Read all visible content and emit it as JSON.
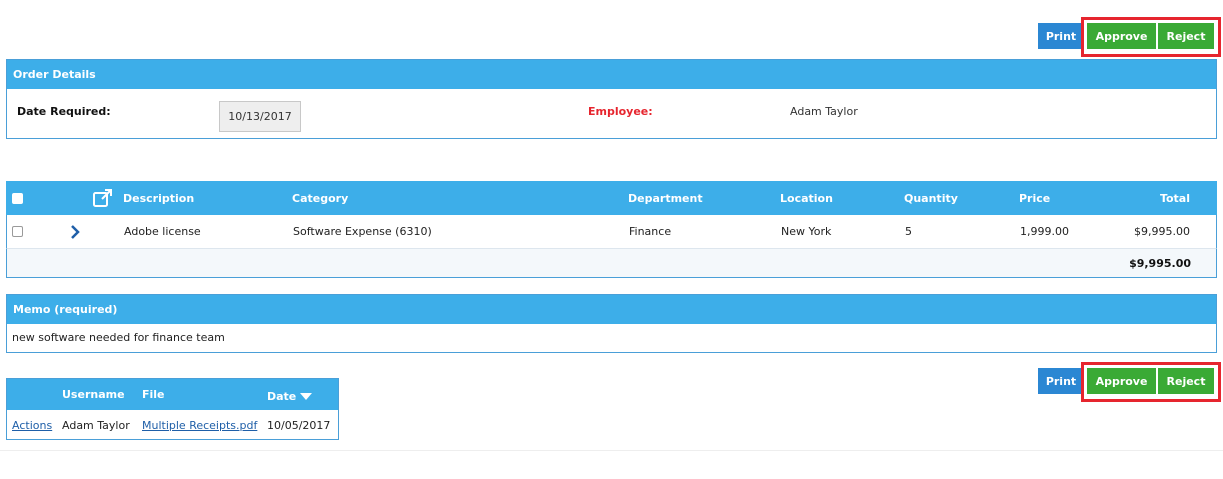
{
  "top_actions": {
    "print": "Print",
    "approve": "Approve",
    "reject": "Reject"
  },
  "order_details": {
    "title": "Order Details",
    "date_required_label": "Date Required:",
    "date_required_value": "10/13/2017",
    "employee_label": "Employee:",
    "employee_value": "Adam Taylor"
  },
  "items_table": {
    "columns": [
      "Description",
      "Category",
      "Department",
      "Location",
      "Quantity",
      "Price",
      "Total"
    ],
    "rows": [
      {
        "description": "Adobe license",
        "category": "Software Expense (6310)",
        "department": "Finance",
        "location": "New York",
        "quantity": "5",
        "price": "1,999.00",
        "total": "$9,995.00"
      }
    ],
    "grand_total": "$9,995.00"
  },
  "memo": {
    "title": "Memo (required)",
    "text": "new software needed for finance team"
  },
  "attachments": {
    "columns": [
      "Username",
      "File",
      "Date"
    ],
    "rows": [
      {
        "action": "Actions",
        "username": "Adam Taylor",
        "file": "Multiple Receipts.pdf",
        "date": "10/05/2017"
      }
    ]
  },
  "bottom_actions": {
    "print": "Print",
    "approve": "Approve",
    "reject": "Reject"
  },
  "colors": {
    "header_blue": "#3daee9",
    "print_blue": "#2b87d3",
    "approve_green": "#3aaa35",
    "highlight_red": "#e6252e"
  }
}
